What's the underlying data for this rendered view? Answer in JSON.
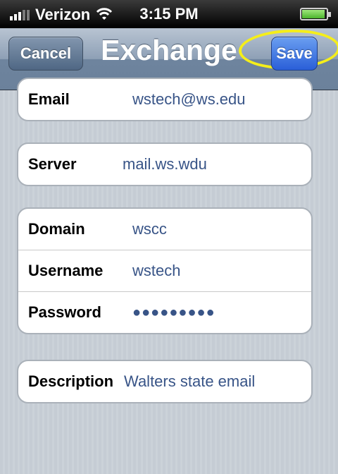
{
  "status_bar": {
    "carrier": "Verizon",
    "time": "3:15 PM",
    "icons": [
      "signal-icon",
      "wifi-icon",
      "battery-icon"
    ]
  },
  "nav_bar": {
    "title": "Exchange",
    "cancel_label": "Cancel",
    "save_label": "Save",
    "highlight_color": "#f5ee1a"
  },
  "account": {
    "email": {
      "label": "Email",
      "value": "wstech@ws.edu"
    },
    "server": {
      "label": "Server",
      "value": "mail.ws.wdu"
    },
    "domain": {
      "label": "Domain",
      "value": "wscc"
    },
    "username": {
      "label": "Username",
      "value": "wstech"
    },
    "password": {
      "label": "Password",
      "value": "●●●●●●●●●"
    },
    "description": {
      "label": "Description",
      "value": "Walters state email"
    }
  },
  "colors": {
    "value_text": "#385487",
    "nav_bar": "#6e849e",
    "background": "#c5ccd4"
  }
}
